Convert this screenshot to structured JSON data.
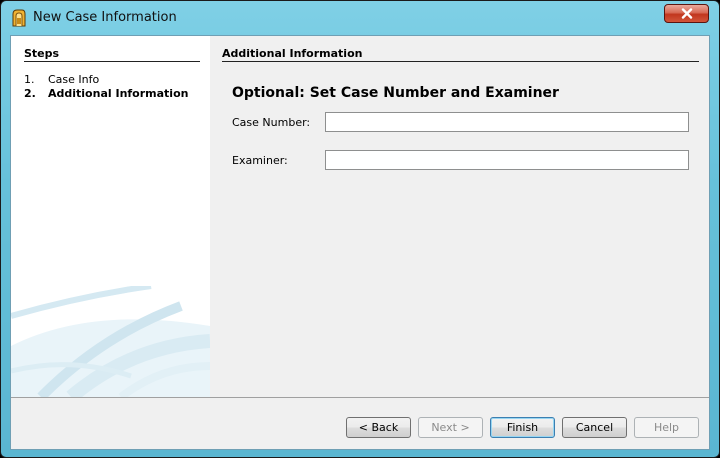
{
  "window": {
    "title": "New Case Information",
    "app_icon": "case-wizard-icon",
    "close_icon": "close-icon"
  },
  "steps": {
    "heading": "Steps",
    "items": [
      {
        "number": "1.",
        "label": "Case Info",
        "active": false
      },
      {
        "number": "2.",
        "label": "Additional Information",
        "active": true
      }
    ]
  },
  "panel": {
    "title": "Additional Information",
    "heading": "Optional: Set Case Number and Examiner",
    "case_number": {
      "label": "Case Number:",
      "value": ""
    },
    "examiner": {
      "label": "Examiner:",
      "value": ""
    }
  },
  "buttons": {
    "back": "< Back",
    "next": "Next >",
    "finish": "Finish",
    "cancel": "Cancel",
    "help": "Help"
  },
  "colors": {
    "frame": "#66c1da",
    "close": "#c1361e",
    "default_button": "#3c7fb1"
  }
}
